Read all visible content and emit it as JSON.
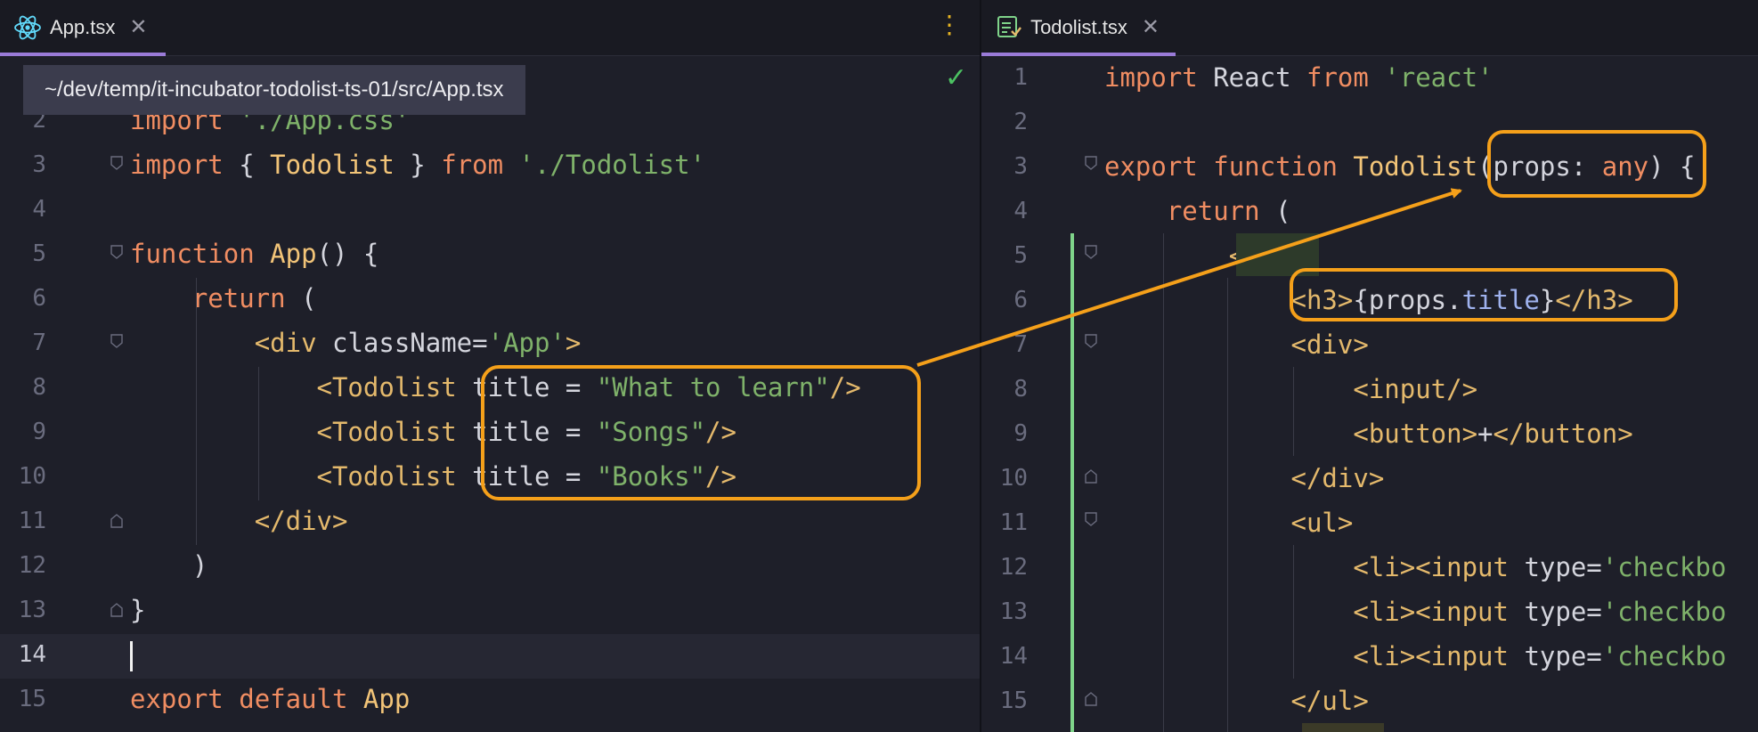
{
  "left_editor": {
    "tab": {
      "label": "App.tsx",
      "icon": "react-atom-icon",
      "close": "✕"
    },
    "kebab": "⋮",
    "status_check": "✓",
    "path_tooltip": "~/dev/temp/it-incubator-todolist-ts-01/src/App.tsx",
    "line_numbers": [
      "2",
      "3",
      "4",
      "5",
      "6",
      "7",
      "8",
      "9",
      "10",
      "11",
      "12",
      "13",
      "14",
      "15"
    ]
  },
  "right_editor": {
    "tab": {
      "label": "Todolist.tsx",
      "icon": "todolist-file-icon",
      "close": "✕"
    },
    "line_numbers": [
      "1",
      "2",
      "3",
      "4",
      "5",
      "6",
      "7",
      "8",
      "9",
      "10",
      "11",
      "12",
      "13",
      "14",
      "15"
    ]
  },
  "colors": {
    "background": "#1e1f29",
    "keyword": "#f08d62",
    "function_name": "#f2c478",
    "string": "#7fb26a",
    "annotation": "#f5a01a",
    "tab_accent": "#9a7bd8"
  }
}
